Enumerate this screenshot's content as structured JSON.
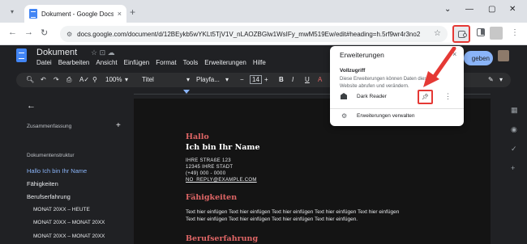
{
  "browser": {
    "tab_title": "Dokument - Google Docs",
    "tab_close": "×",
    "new_tab": "+",
    "url": "docs.google.com/document/d/12BEykb5wYKLt5TjV1V_nLAOZBGlw1WsIFy_mwM519Ew/edit#heading=h.5rf9wr4r3no2",
    "window_controls": [
      "⌄",
      "—",
      "▢",
      "✕"
    ]
  },
  "docs": {
    "title": "Dokument",
    "menu": [
      "Datei",
      "Bearbeiten",
      "Ansicht",
      "Einfügen",
      "Format",
      "Tools",
      "Erweiterungen",
      "Hilfe"
    ],
    "share_label": "geben",
    "format_toolbar": {
      "zoom": "100%",
      "style": "Titel",
      "font": "Playfa...",
      "size": "14"
    }
  },
  "sidebar": {
    "summary_label": "Zusammenfassung",
    "structure_label": "Dokumentenstruktur",
    "items": [
      {
        "label": "Hallo Ich bin Ihr Name",
        "active": true,
        "sub": false
      },
      {
        "label": "Fähigkeiten",
        "active": false,
        "sub": false
      },
      {
        "label": "Berufserfahrung",
        "active": false,
        "sub": false
      },
      {
        "label": "MONAT 20XX – HEUTE",
        "active": false,
        "sub": true
      },
      {
        "label": "MONAT 20XX – MONAT 20XX",
        "active": false,
        "sub": true
      },
      {
        "label": "MONAT 20XX – MONAT 20XX",
        "active": false,
        "sub": true
      }
    ]
  },
  "page": {
    "hallo": "Hallo",
    "name": "Ich bin Ihr Name",
    "address": [
      "IHRE STRAßE 123",
      "12345 IHRE STADT",
      "(+49) 000 - 0000",
      "NO_REPLY@EXAMPLE.COM"
    ],
    "section1": "Fähigkeiten",
    "body_line1": "Text hier einfügen Text hier einfügen Text hier einfügen Text hier einfügen Text hier einfügen",
    "body_line2": "Text hier einfügen Text hier einfügen Text hier einfügen Text hier einfügen.",
    "section2": "Berufserfahrung"
  },
  "popup": {
    "title": "Erweiterungen",
    "close": "×",
    "heading": "Vollzugriff",
    "description": "Diese Erweiterungen können Daten dieser Website abrufen und verändern.",
    "extension_name": "Dark Reader",
    "manage_label": "Erweiterungen verwalten"
  },
  "colors": {
    "annotation_red": "#e53935",
    "accent_blue": "#8ab4f8",
    "heading_red": "#e06666"
  }
}
